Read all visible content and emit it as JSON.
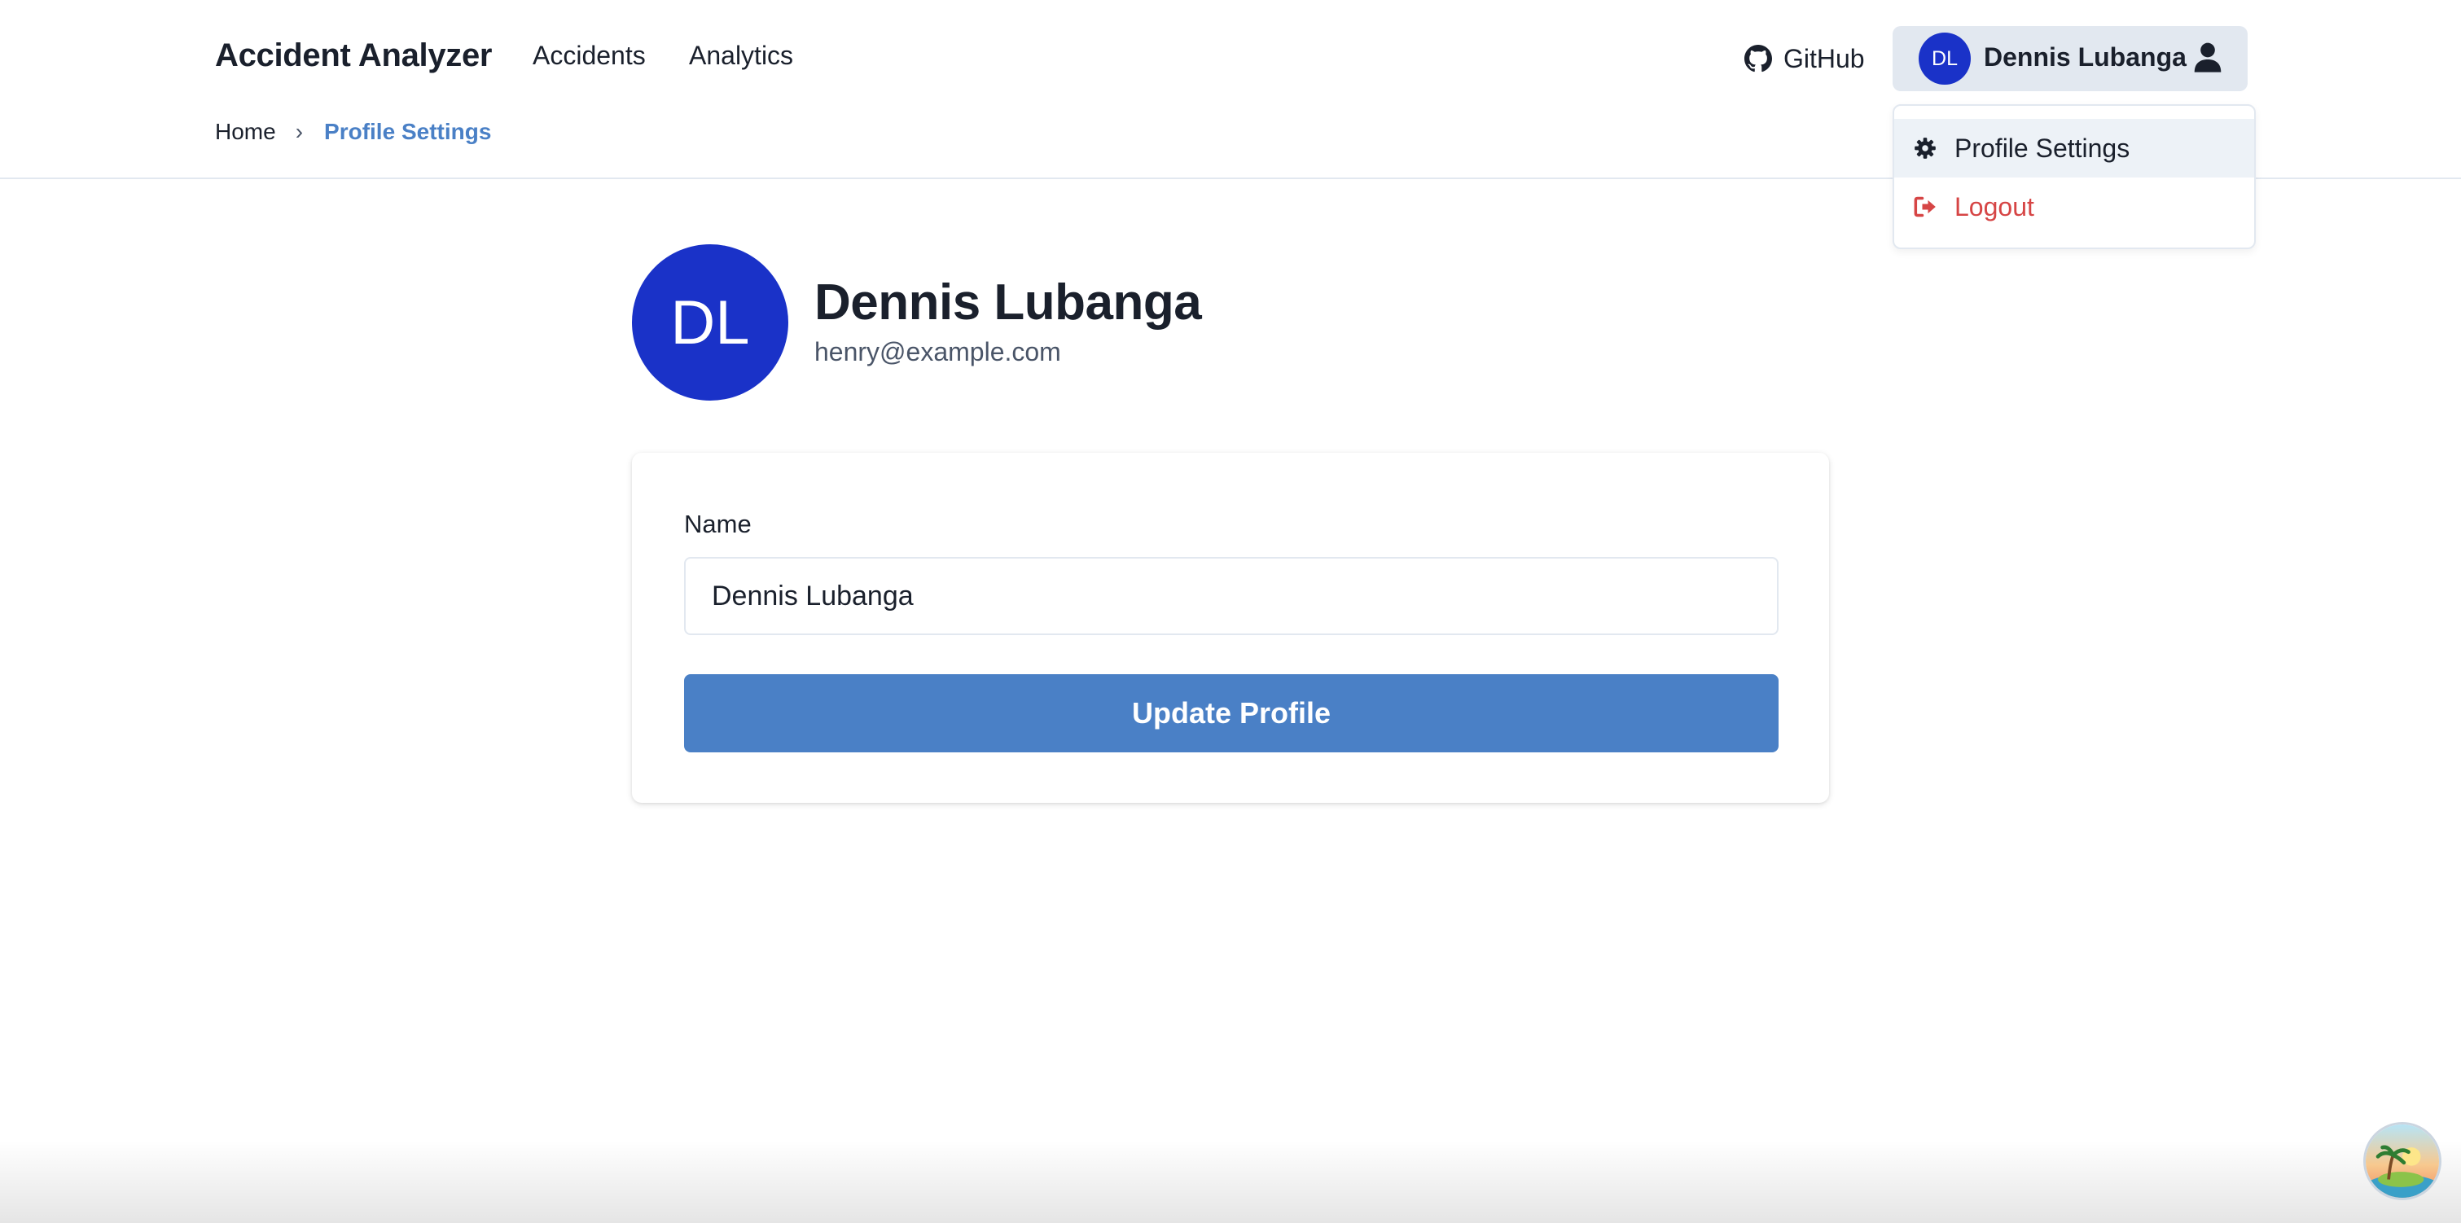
{
  "header": {
    "brand": "Accident Analyzer",
    "nav": [
      {
        "label": "Accidents"
      },
      {
        "label": "Analytics"
      }
    ],
    "github_label": "GitHub",
    "user": {
      "initials": "DL",
      "name": "Dennis Lubanga"
    }
  },
  "breadcrumb": {
    "home": "Home",
    "separator": "›",
    "current": "Profile Settings"
  },
  "dropdown": {
    "items": [
      {
        "label": "Profile Settings",
        "icon": "gear-icon"
      },
      {
        "label": "Logout",
        "icon": "logout-icon"
      }
    ]
  },
  "profile": {
    "initials": "DL",
    "name": "Dennis Lubanga",
    "email": "henry@example.com"
  },
  "form": {
    "name_label": "Name",
    "name_value": "Dennis Lubanga",
    "submit_label": "Update Profile"
  },
  "colors": {
    "avatar": "#1a32c8",
    "accent": "#4a80c6",
    "danger": "#d64545",
    "user_button_bg": "#e2e8f0"
  }
}
